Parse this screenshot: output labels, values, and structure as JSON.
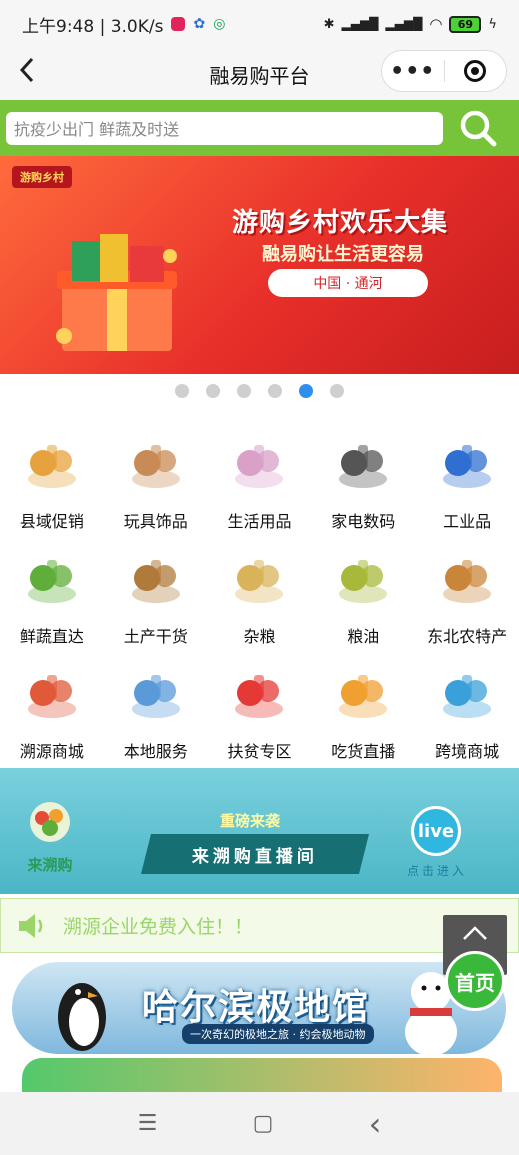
{
  "status_bar": {
    "time_speed": "上午9:48 | 3.0K/s",
    "battery": "69"
  },
  "navbar": {
    "back_icon": "chevron-left-icon",
    "title": "融易购平台",
    "more_label": "•••"
  },
  "search": {
    "placeholder": "抗疫少出门 鲜蔬及时送",
    "icon": "search-icon",
    "accent": "#77c33a"
  },
  "banner": {
    "badge": "游购乡村",
    "headline": "游购乡村欢乐大集",
    "tagline": "融易购让生活更容易",
    "location": "中国 · 通河",
    "dots_total": 6,
    "dots_active_index": 4
  },
  "categories": [
    [
      {
        "label": "县域促销",
        "icon": "wine-groceries-icon",
        "color": "#e6a23c"
      },
      {
        "label": "玩具饰品",
        "icon": "teddy-bear-icon",
        "color": "#c98b55"
      },
      {
        "label": "生活用品",
        "icon": "toiletries-icon",
        "color": "#d9a0c8"
      },
      {
        "label": "家电数码",
        "icon": "appliances-icon",
        "color": "#555555"
      },
      {
        "label": "工业品",
        "icon": "gears-icon",
        "color": "#2f6fd1"
      }
    ],
    [
      {
        "label": "鲜蔬直达",
        "icon": "vegetables-icon",
        "color": "#5fae3a"
      },
      {
        "label": "土产干货",
        "icon": "dried-goods-icon",
        "color": "#b07a3a"
      },
      {
        "label": "杂粮",
        "icon": "grains-icon",
        "color": "#d9b35a"
      },
      {
        "label": "粮油",
        "icon": "oil-bottle-icon",
        "color": "#a8b83a"
      },
      {
        "label": "东北农特产",
        "icon": "specialty-basket-icon",
        "color": "#c9853a"
      }
    ],
    [
      {
        "label": "溯源商城",
        "icon": "storefront-icon",
        "color": "#e05a3a"
      },
      {
        "label": "本地服务",
        "icon": "service-people-icon",
        "color": "#5a9ad9"
      },
      {
        "label": "扶贫专区",
        "icon": "heart-hands-icon",
        "color": "#e53935"
      },
      {
        "label": "吃货直播",
        "icon": "food-live-icon",
        "color": "#f0a030"
      },
      {
        "label": "跨境商城",
        "icon": "globe-plane-icon",
        "color": "#3aa0d9"
      }
    ]
  ],
  "live_banner": {
    "logo_text": "来溯购",
    "tag": "重磅来袭",
    "plate": "来溯购直播间",
    "live_badge": "live",
    "enter": "点击进入"
  },
  "notice": {
    "icon": "speaker-icon",
    "text": "溯源企业免费入住！！"
  },
  "float_buttons": {
    "up_icon": "chevron-up-icon",
    "home_label": "首页"
  },
  "harbin_banner": {
    "title": "哈尔滨极地馆",
    "subtitle": "一次奇幻的极地之旅 · 约会极地动物"
  },
  "system_nav": {
    "menu": "☰",
    "home": "▢",
    "back": "‹"
  }
}
